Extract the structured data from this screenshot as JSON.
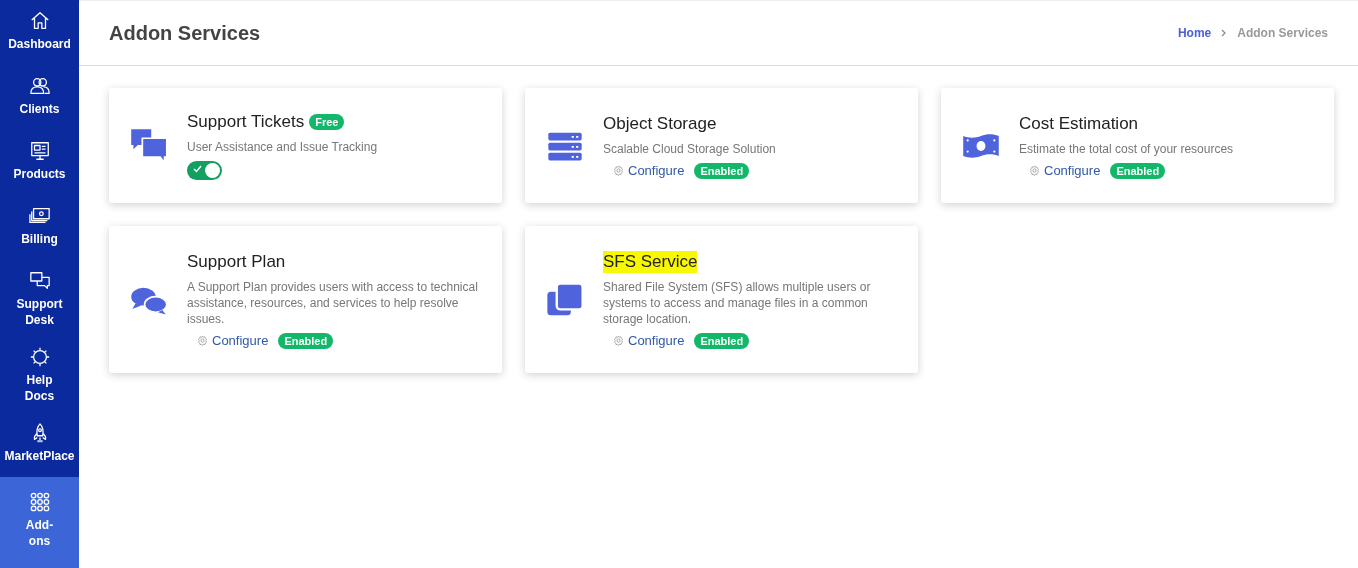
{
  "sidebar": {
    "items": [
      {
        "label": "Dashboard",
        "selected": false
      },
      {
        "label": "Clients",
        "selected": false
      },
      {
        "label": "Products",
        "selected": false
      },
      {
        "label": "Billing",
        "selected": false
      },
      {
        "label": "Support Desk",
        "selected": false
      },
      {
        "label": "Help Docs",
        "selected": false
      },
      {
        "label": "MarketPlace",
        "selected": false
      },
      {
        "label": "Add-ons",
        "selected": true
      }
    ]
  },
  "header": {
    "title": "Addon Services",
    "breadcrumb": [
      {
        "label": "Home",
        "selected": false
      },
      {
        "label": "Addon Services",
        "selected": true
      }
    ]
  },
  "cards": [
    {
      "kind": "toggle",
      "title": "Support Tickets",
      "badge": "Free",
      "description": "User Assistance and Issue Tracking",
      "on": true,
      "highlighted": false
    },
    {
      "kind": "configure",
      "title": "Object Storage",
      "description": "Scalable Cloud Storage Solution",
      "link": "Configure",
      "status": "Enabled",
      "highlighted": false
    },
    {
      "kind": "configure",
      "title": "Cost Estimation",
      "description": "Estimate the total cost of your resources",
      "link": "Configure",
      "status": "Enabled",
      "highlighted": false
    },
    {
      "kind": "configure",
      "title": "Support Plan",
      "description": "A Support Plan provides users with access to technical assistance, resources, and services to help resolve issues.",
      "link": "Configure",
      "status": "Enabled",
      "highlighted": false
    },
    {
      "kind": "configure",
      "title": "SFS Service",
      "description": "Shared File System (SFS) allows multiple users or systems to access and manage files in a common storage location.",
      "link": "Configure",
      "status": "Enabled",
      "highlighted": true
    }
  ]
}
